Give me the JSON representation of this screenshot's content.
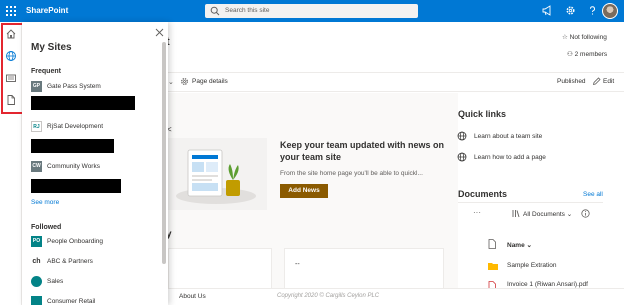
{
  "header": {
    "app_name": "SharePoint",
    "search_placeholder": "Search this site",
    "accent": "#0078d4"
  },
  "rail": {
    "items": [
      {
        "icon": "home-icon"
      },
      {
        "icon": "globe-icon"
      },
      {
        "icon": "news-icon"
      },
      {
        "icon": "document-icon"
      }
    ],
    "highlight_color": "#e3262f"
  },
  "my_sites": {
    "title": "My Sites",
    "frequent_heading": "Frequent",
    "frequent": [
      {
        "abbr": "GP",
        "label": "Gate Pass System",
        "color": "#69797e"
      },
      {
        "abbr": "RJ",
        "label": "RjSat Development",
        "color": "#ffffff"
      },
      {
        "abbr": "CW",
        "label": "Community Works",
        "color": "#69797e"
      }
    ],
    "see_more": "See more",
    "followed_heading": "Followed",
    "followed": [
      {
        "abbr": "PO",
        "label": "People Onboarding",
        "color": "#038387"
      },
      {
        "abbr": "ch",
        "label": "ABC & Partners",
        "color": "#ffffff"
      },
      {
        "abbr": "",
        "label": "Sales",
        "color": "#038387"
      },
      {
        "abbr": "",
        "label": "Consumer Retail",
        "color": "#038387"
      }
    ]
  },
  "site_header": {
    "title_fragment": "t",
    "follow": "Not following",
    "members": "2 members"
  },
  "command_bar": {
    "page_details": "Page details",
    "published": "Published",
    "edit": "Edit"
  },
  "news": {
    "title": "Keep your team updated with news on your team site",
    "description": "From the site home page you'll be able to quickl...",
    "button": "Add News",
    "button_color": "#8a5a00"
  },
  "sections": {
    "frag1": "<",
    "frag2": "y",
    "card_text": "--"
  },
  "quick_links": {
    "title": "Quick links",
    "items": [
      {
        "label": "Learn about a team site"
      },
      {
        "label": "Learn how to add a page"
      }
    ]
  },
  "documents": {
    "title": "Documents",
    "see_all": "See all",
    "ellipsis": "···",
    "view": "All Documents",
    "column_name": "Name",
    "rows": [
      {
        "name": "Sample Extration"
      },
      {
        "name": "Invoice 1 (Riwan Ansari).pdf"
      }
    ]
  },
  "footer": {
    "about": "About Us",
    "copyright": "Copyright 2020 © Cargills Ceylon PLC"
  }
}
